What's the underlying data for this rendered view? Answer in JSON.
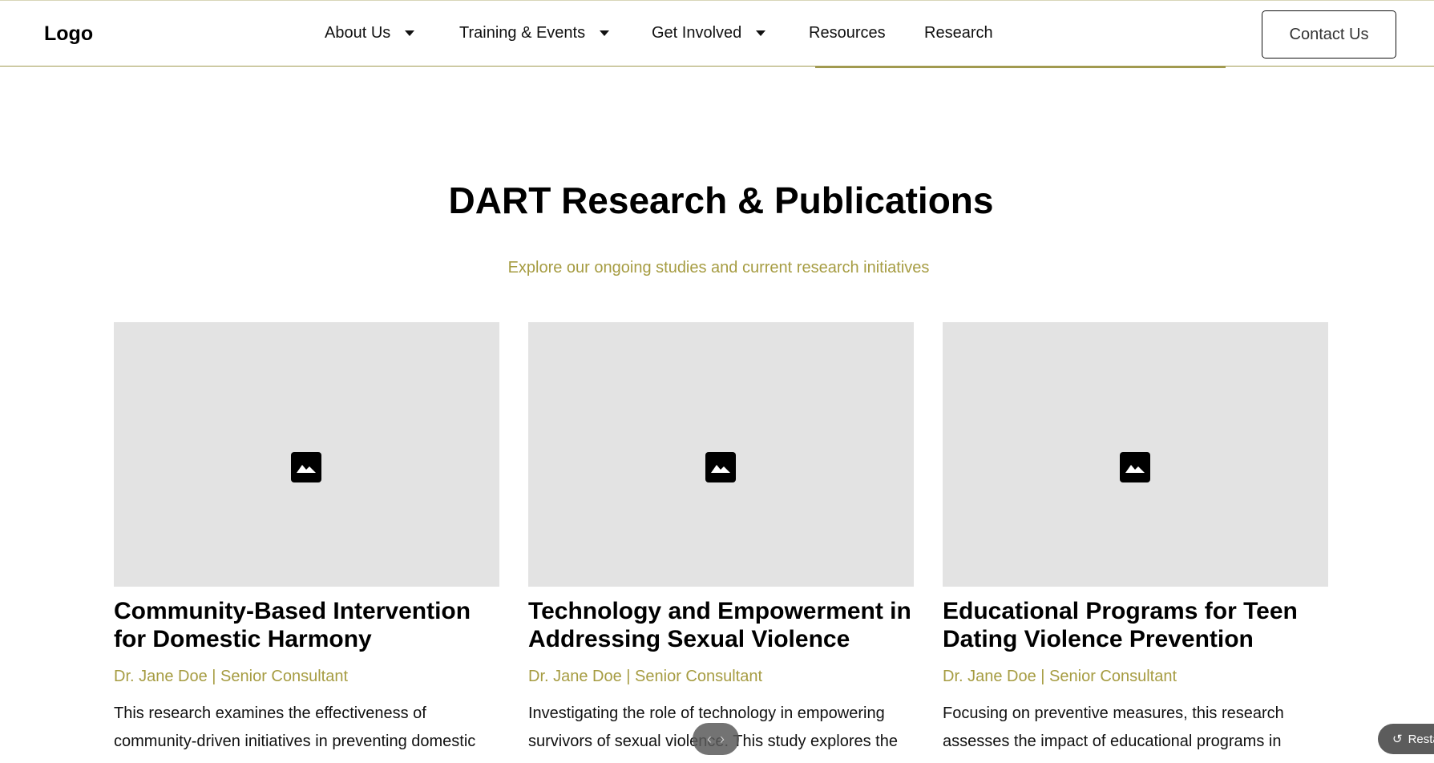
{
  "header": {
    "logo": "Logo",
    "nav": [
      {
        "label": "About Us",
        "dropdown": true
      },
      {
        "label": "Training & Events",
        "dropdown": true
      },
      {
        "label": "Get Involved",
        "dropdown": true
      },
      {
        "label": "Resources",
        "dropdown": false
      },
      {
        "label": "Research",
        "dropdown": false
      }
    ],
    "contact_label": "Contact Us"
  },
  "section": {
    "title": "DART Research & Publications",
    "subtitle": "Explore our ongoing studies and current research initiatives"
  },
  "cards": [
    {
      "title": "Community-Based Intervention for Domestic Harmony",
      "author": "Dr. Jane Doe | Senior Consultant",
      "excerpt": "This research examines the effectiveness of community-driven initiatives in preventing domestic",
      "image_icon": "image-icon"
    },
    {
      "title": "Technology and Empowerment in Addressing Sexual Violence",
      "author": "Dr. Jane Doe | Senior Consultant",
      "excerpt": "Investigating the role of technology in empowering survivors of sexual violence. This study explores the",
      "image_icon": "image-icon"
    },
    {
      "title": "Educational Programs for Teen Dating Violence Prevention",
      "author": "Dr. Jane Doe | Senior Consultant",
      "excerpt": "Focusing on preventive measures, this research assesses the impact of educational programs in",
      "image_icon": "image-icon"
    }
  ],
  "overlay": {
    "restore_label": "Resta",
    "restore_icon": "undo-icon",
    "carousel_icons": [
      "chevron-left-icon",
      "chevron-right-icon"
    ]
  },
  "colors": {
    "accent": "#a69c42",
    "placeholder": "#e3e3e3",
    "text": "#111111"
  }
}
